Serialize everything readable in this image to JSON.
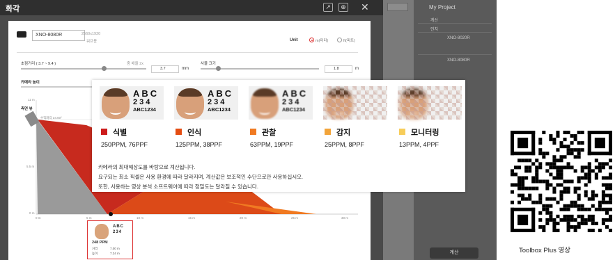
{
  "dialog": {
    "title": "화각",
    "model": "XNO-8080R",
    "resolution": "2560x1920",
    "checkbox_label": "워프용",
    "unit_label": "Unit",
    "unit_options": [
      "m(미터)",
      "ft(피트)"
    ],
    "focal_label": "초점거리 ( 3.7 ~ 9.4 )",
    "focal_side_label": "줌 배율 2x",
    "focal_value": "3.7",
    "focal_unit": "mm",
    "object_size_label": "사물 크기",
    "object_size_value": "1.8",
    "object_size_unit": "m",
    "camera_height_label": "카메라 높이",
    "side_view_label": "측면 뷰",
    "vertical_fov": "수직화각 34.60°",
    "axis_y": [
      "11 m",
      "5.5 m",
      "0 m"
    ],
    "axis_x": [
      "0 m",
      "5 m",
      "10 m",
      "15 m",
      "20 m",
      "25 m",
      "30 m"
    ]
  },
  "thumbnail": {
    "abc": "ABC",
    "num": "234",
    "ppm": "248 PPM",
    "dist_label": "거리",
    "dist": "7.00 m",
    "height_label": "높이",
    "height": "7.24 m"
  },
  "right_panel": {
    "title": "My Project",
    "rows": [
      "계산",
      "인치",
      "XNO-8020R",
      "XNO-8080R"
    ],
    "button": "계산"
  },
  "levels": [
    {
      "name": "식별",
      "value": "250PPM, 76PPF",
      "color": "#cc1b1b",
      "abc": "ABC",
      "num": "234",
      "code": "ABC1234",
      "blur": 0
    },
    {
      "name": "인식",
      "value": "125PPM, 38PPF",
      "color": "#e44d12",
      "abc": "ABC",
      "num": "234",
      "code": "ABC1234",
      "blur": 0
    },
    {
      "name": "관찰",
      "value": "63PPM, 19PPF",
      "color": "#f07a22",
      "abc": "ABC",
      "num": "234",
      "code": "ABC1234",
      "blur": 1
    },
    {
      "name": "감지",
      "value": "25PPM, 8PPF",
      "color": "#f2a43a",
      "abc": "",
      "num": "",
      "code": "",
      "blur": 2
    },
    {
      "name": "모니터링",
      "value": "13PPM, 4PPF",
      "color": "#f7cd5a",
      "abc": "",
      "num": "",
      "code": "",
      "blur": 3
    }
  ],
  "notes": [
    "카메라의 최대해상도를 바탕으로 계산됩니다.",
    "요구되는 최소 픽셀은 사용 환경에 따라 달라지며, 계산값은 보조적인 수단으로만 사용하십시오.",
    "또한, 사용하는 영상 분석 소프트웨어에 따라 정밀도는 달라질 수 있습니다."
  ],
  "qr_caption": "Toolbox Plus 영상"
}
